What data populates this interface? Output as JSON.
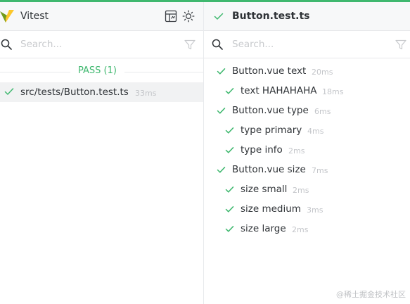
{
  "app": {
    "title": "Vitest"
  },
  "colors": {
    "accent": "#3fb86f",
    "muted": "#c3c5c9",
    "text": "#2f3337"
  },
  "left": {
    "search_placeholder": "Search...",
    "pass_label": "PASS (1)",
    "file": {
      "name": "src/tests/Button.test.ts",
      "duration": "33ms",
      "status": "pass"
    }
  },
  "right": {
    "title": "Button.test.ts",
    "search_placeholder": "Search...",
    "tests": [
      {
        "name": "Button.vue text",
        "duration": "20ms",
        "level": 0
      },
      {
        "name": "text HAHAHAHA",
        "duration": "18ms",
        "level": 1
      },
      {
        "name": "Button.vue type",
        "duration": "6ms",
        "level": 0
      },
      {
        "name": "type primary",
        "duration": "4ms",
        "level": 1
      },
      {
        "name": "type info",
        "duration": "2ms",
        "level": 1
      },
      {
        "name": "Button.vue size",
        "duration": "7ms",
        "level": 0
      },
      {
        "name": "size small",
        "duration": "2ms",
        "level": 1
      },
      {
        "name": "size medium",
        "duration": "3ms",
        "level": 1
      },
      {
        "name": "size large",
        "duration": "2ms",
        "level": 1
      }
    ]
  },
  "icons": [
    "vitest-logo-icon",
    "dashboard-icon",
    "theme-toggle-icon",
    "search-icon",
    "filter-icon",
    "check-icon"
  ],
  "watermark": "@稀土掘金技术社区"
}
